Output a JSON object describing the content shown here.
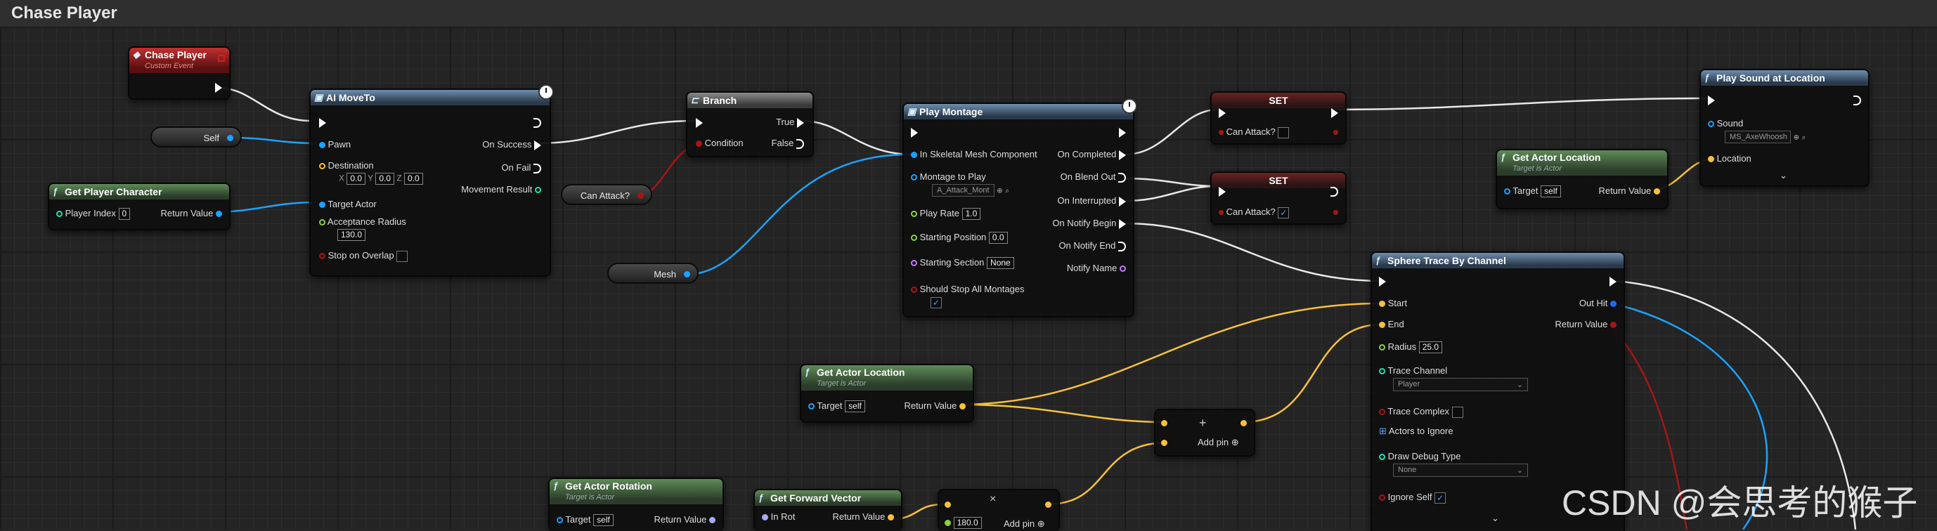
{
  "title": "Chase Player",
  "watermark": "CSDN @会思考的猴子",
  "colors": {
    "exec": "#ffffff",
    "object": "#1aa3ff",
    "vector": "#f7c13a",
    "float": "#86d34a",
    "bool": "#a81515",
    "int": "#1fe0b0",
    "name": "#c57af5",
    "event": "#c92424"
  },
  "event_node": {
    "title": "Chase Player",
    "subtitle": "Custom Event"
  },
  "self_var": {
    "label": "Self"
  },
  "can_attack_var": {
    "label": "Can Attack?"
  },
  "mesh_var": {
    "label": "Mesh"
  },
  "get_player_character": {
    "title": "Get Player Character",
    "player_index_label": "Player Index",
    "player_index": "0",
    "return_label": "Return Value"
  },
  "ai_moveto": {
    "title": "AI MoveTo",
    "pawn": "Pawn",
    "destination": "Destination",
    "x_label": "X",
    "x": "0.0",
    "y_label": "Y",
    "y": "0.0",
    "z_label": "Z",
    "z": "0.0",
    "target_actor": "Target Actor",
    "acceptance_radius": "Acceptance Radius",
    "acceptance_value": "130.0",
    "stop_on_overlap": "Stop on Overlap",
    "on_success": "On Success",
    "on_fail": "On Fail",
    "movement_result": "Movement Result"
  },
  "branch": {
    "title": "Branch",
    "condition": "Condition",
    "true_label": "True",
    "false_label": "False"
  },
  "play_montage": {
    "title": "Play Montage",
    "in_skeletal": "In Skeletal Mesh Component",
    "montage_to_play": "Montage to Play",
    "montage_value": "A_Attack_Mont",
    "play_rate": "Play Rate",
    "play_rate_value": "1.0",
    "starting_position": "Starting Position",
    "starting_position_value": "0.0",
    "starting_section": "Starting Section",
    "starting_section_value": "None",
    "should_stop": "Should Stop All Montages",
    "on_completed": "On Completed",
    "on_blend_out": "On Blend Out",
    "on_interrupted": "On Interrupted",
    "on_notify_begin": "On Notify Begin",
    "on_notify_end": "On Notify End",
    "notify_name": "Notify Name"
  },
  "set1": {
    "title": "SET",
    "label": "Can Attack?"
  },
  "set2": {
    "title": "SET",
    "label": "Can Attack?"
  },
  "play_sound": {
    "title": "Play Sound at Location",
    "sound": "Sound",
    "sound_value": "MS_AxeWhoosh",
    "location": "Location"
  },
  "get_actor_location_top": {
    "title": "Get Actor Location",
    "subtitle": "Target is Actor",
    "target": "Target",
    "target_value": "self",
    "return_label": "Return Value"
  },
  "sphere_trace": {
    "title": "Sphere Trace By Channel",
    "start": "Start",
    "end": "End",
    "radius": "Radius",
    "radius_value": "25.0",
    "trace_channel": "Trace Channel",
    "trace_channel_value": "Player",
    "trace_complex": "Trace Complex",
    "actors_to_ignore": "Actors to Ignore",
    "draw_debug_type": "Draw Debug Type",
    "draw_debug_value": "None",
    "ignore_self": "Ignore Self",
    "out_hit": "Out Hit",
    "return_value": "Return Value"
  },
  "get_actor_location_mid": {
    "title": "Get Actor Location",
    "subtitle": "Target is Actor",
    "target": "Target",
    "target_value": "self",
    "return_label": "Return Value"
  },
  "add_node_1": {
    "plus": "+",
    "add_pin": "Add pin"
  },
  "get_actor_rotation": {
    "title": "Get Actor Rotation",
    "subtitle": "Target is Actor",
    "target": "Target",
    "target_value": "self",
    "return_label": "Return Value"
  },
  "get_forward_vector": {
    "title": "Get Forward Vector",
    "in_rot": "In Rot",
    "return_label": "Return Value"
  },
  "multiply_node": {
    "times": "×",
    "value": "180.0",
    "add_pin": "Add pin"
  }
}
